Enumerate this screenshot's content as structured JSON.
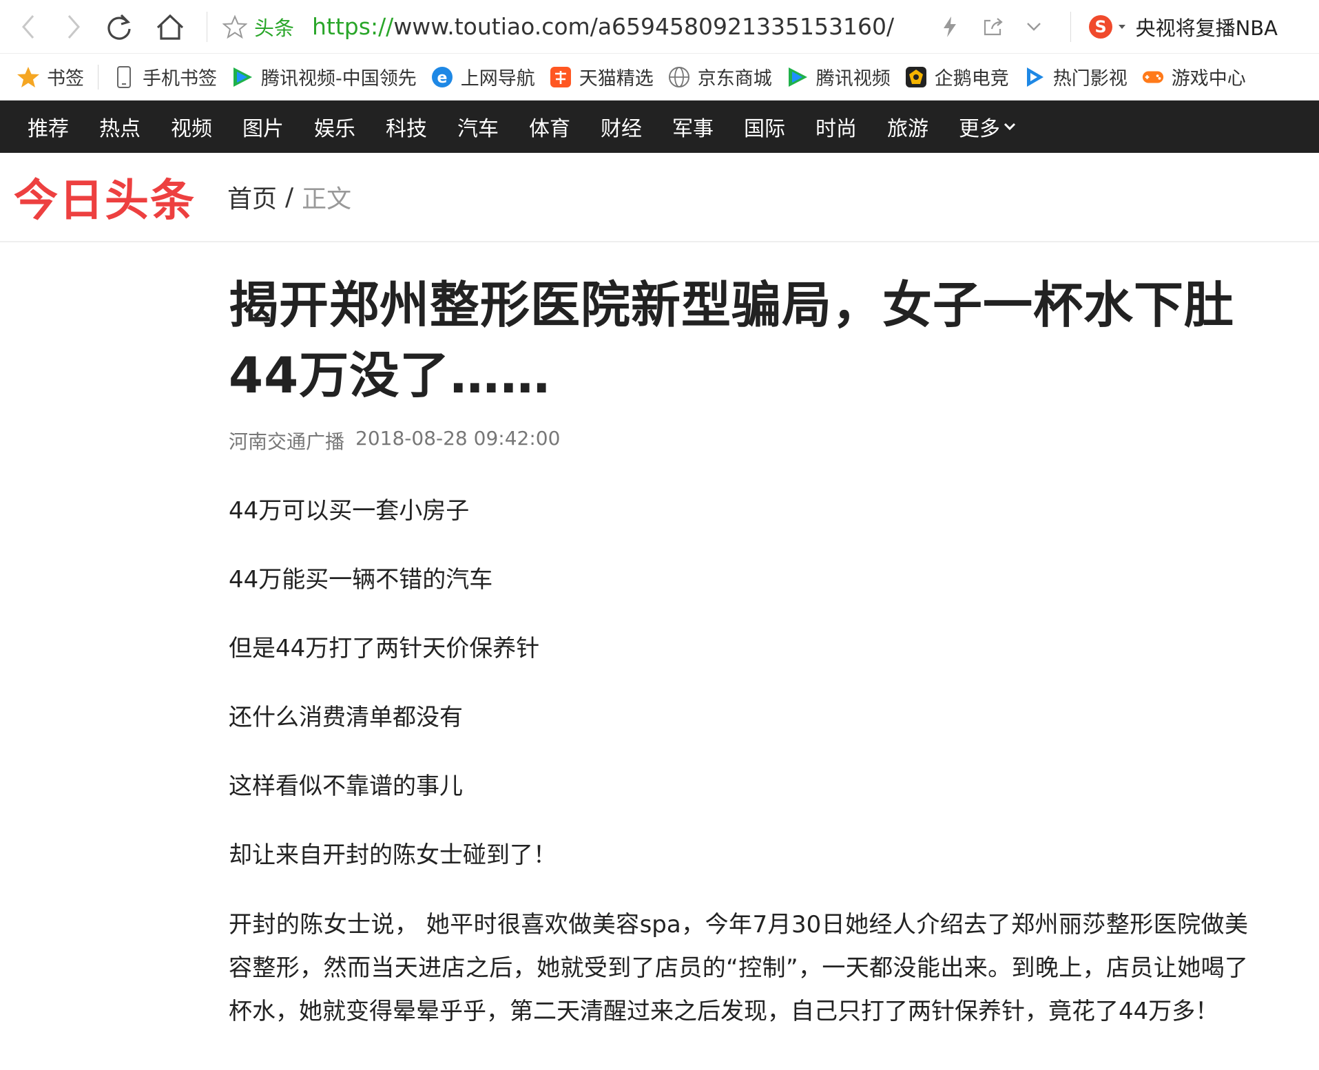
{
  "browser": {
    "site_tag": "头条",
    "url_proto": "https://",
    "url_rest": "www.toutiao.com/a6594580921335153160/",
    "hot_news": "央视将复播NBA"
  },
  "bookmarks": [
    {
      "label": "书签",
      "icon": "star-icon"
    },
    {
      "label": "手机书签",
      "icon": "phone-icon"
    },
    {
      "label": "腾讯视频-中国领先",
      "icon": "tencent-video-icon"
    },
    {
      "label": "上网导航",
      "icon": "ie-icon"
    },
    {
      "label": "天猫精选",
      "icon": "taobao-icon"
    },
    {
      "label": "京东商城",
      "icon": "globe-icon"
    },
    {
      "label": "腾讯视频",
      "icon": "tencent-video-icon"
    },
    {
      "label": "企鹅电竞",
      "icon": "penguin-esports-icon"
    },
    {
      "label": "热门影视",
      "icon": "play-icon"
    },
    {
      "label": "游戏中心",
      "icon": "gamepad-icon"
    }
  ],
  "channels": [
    "推荐",
    "热点",
    "视频",
    "图片",
    "娱乐",
    "科技",
    "汽车",
    "体育",
    "财经",
    "军事",
    "国际",
    "时尚",
    "旅游"
  ],
  "more_label": "更多",
  "header": {
    "logo": "今日头条",
    "breadcrumb_home": "首页",
    "breadcrumb_sep": "/",
    "breadcrumb_current": "正文"
  },
  "article": {
    "title": "揭开郑州整形医院新型骗局，女子一杯水下肚 44万没了……",
    "source": "河南交通广播",
    "datetime": "2018-08-28 09:42:00",
    "paragraphs": [
      "44万可以买一套小房子",
      "44万能买一辆不错的汽车",
      "但是44万打了两针天价保养针",
      "还什么消费清单都没有",
      "这样看似不靠谱的事儿",
      "却让来自开封的陈女士碰到了！",
      "开封的陈女士说， 她平时很喜欢做美容spa，今年7月30日她经人介绍去了郑州丽莎整形医院做美容整形，然而当天进店之后，她就受到了店员的“控制”，一天都没能出来。到晚上，店员让她喝了杯水，她就变得晕晕乎乎，第二天清醒过来之后发现，自己只打了两针保养针，竟花了44万多！"
    ]
  }
}
